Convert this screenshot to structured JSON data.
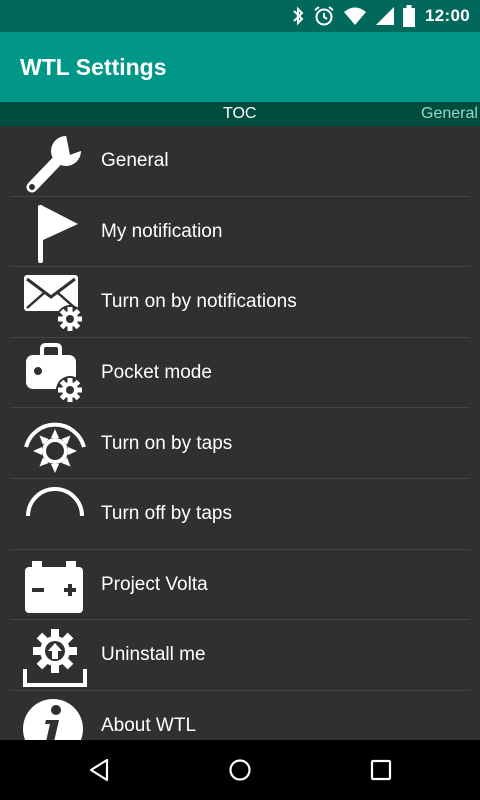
{
  "status_bar": {
    "time": "12:00",
    "icons": [
      "bluetooth-icon",
      "alarm-icon",
      "wifi-icon",
      "signal-icon",
      "battery-icon"
    ]
  },
  "app_bar": {
    "title": "WTL Settings",
    "color": "#009688"
  },
  "tabs": [
    {
      "label": "TOC",
      "active": true
    },
    {
      "label": "General",
      "active": false
    }
  ],
  "menu": {
    "items": [
      {
        "label": "General",
        "icon": "wrench-icon"
      },
      {
        "label": "My notification",
        "icon": "flag-icon"
      },
      {
        "label": "Turn on by notifications",
        "icon": "envelope-gear-icon"
      },
      {
        "label": "Pocket mode",
        "icon": "bag-gear-icon"
      },
      {
        "label": "Turn on by taps",
        "icon": "sun-taps-icon"
      },
      {
        "label": "Turn off by taps",
        "icon": "moon-taps-icon"
      },
      {
        "label": "Project Volta",
        "icon": "battery-volta-icon"
      },
      {
        "label": "Uninstall me",
        "icon": "uninstall-gear-icon"
      },
      {
        "label": "About WTL",
        "icon": "info-icon"
      }
    ]
  },
  "nav_bar": {
    "buttons": [
      "back-icon",
      "home-icon",
      "recents-icon"
    ]
  }
}
